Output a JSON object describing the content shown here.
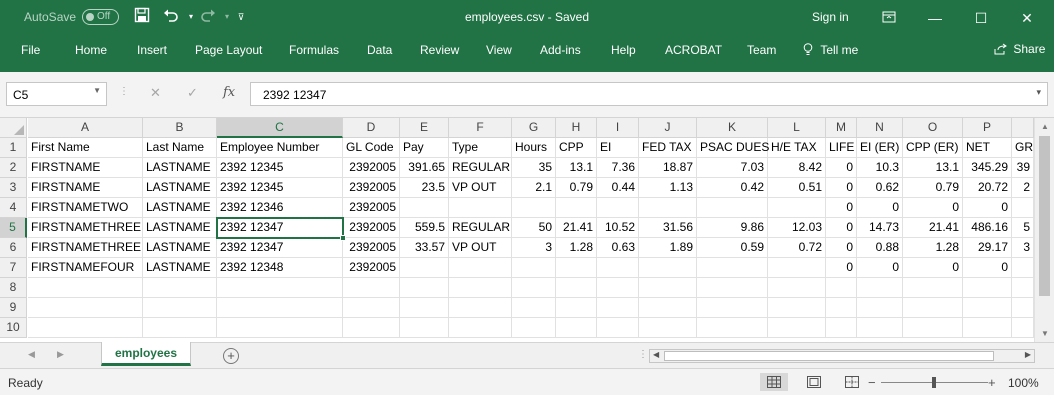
{
  "titlebar": {
    "autosave_label": "AutoSave",
    "autosave_state": "Off",
    "doc_title": "employees.csv  -  Saved",
    "signin": "Sign in",
    "qat_icons": [
      "save-icon",
      "undo-icon",
      "redo-icon",
      "customize-icon"
    ],
    "window_icons": [
      "ribbon-display-icon",
      "minimize-icon",
      "maximize-icon",
      "close-icon"
    ]
  },
  "ribbon": {
    "tabs": [
      "File",
      "Home",
      "Insert",
      "Page Layout",
      "Formulas",
      "Data",
      "Review",
      "View",
      "Add-ins",
      "Help",
      "ACROBAT",
      "Team",
      "Tell me"
    ],
    "share": "Share"
  },
  "formula_bar": {
    "name_box": "C5",
    "formula": "2392  12347",
    "fx": "fx"
  },
  "sheet": {
    "columns": [
      "A",
      "B",
      "C",
      "D",
      "E",
      "F",
      "G",
      "H",
      "I",
      "J",
      "K",
      "L",
      "M",
      "N",
      "O",
      "P",
      ""
    ],
    "row_numbers": [
      "1",
      "2",
      "3",
      "4",
      "5",
      "6",
      "7",
      "8",
      "9",
      "10"
    ],
    "active_cell": "C5",
    "rows": [
      [
        "First Name",
        "Last Name",
        "Employee Number",
        "GL Code",
        "Pay",
        "Type",
        "Hours",
        "CPP",
        "EI",
        "FED TAX",
        "PSAC DUES",
        "H/E TAX",
        "LIFE",
        "EI (ER)",
        "CPP (ER)",
        "NET",
        "GR"
      ],
      [
        "FIRSTNAME",
        "LASTNAME",
        "2392  12345",
        "2392005",
        "391.65",
        "REGULAR",
        "35",
        "13.1",
        "7.36",
        "18.87",
        "7.03",
        "8.42",
        "0",
        "10.3",
        "13.1",
        "345.29",
        "39"
      ],
      [
        "FIRSTNAME",
        "LASTNAME",
        "2392  12345",
        "2392005",
        "23.5",
        "VP OUT",
        "2.1",
        "0.79",
        "0.44",
        "1.13",
        "0.42",
        "0.51",
        "0",
        "0.62",
        "0.79",
        "20.72",
        "2"
      ],
      [
        "FIRSTNAMETWO",
        "LASTNAME",
        "2392  12346",
        "2392005",
        "",
        "",
        "",
        "",
        "",
        "",
        "",
        "",
        "0",
        "0",
        "0",
        "0",
        ""
      ],
      [
        "FIRSTNAMETHREE",
        "LASTNAME",
        "2392  12347",
        "2392005",
        "559.5",
        "REGULAR",
        "50",
        "21.41",
        "10.52",
        "31.56",
        "9.86",
        "12.03",
        "0",
        "14.73",
        "21.41",
        "486.16",
        "5"
      ],
      [
        "FIRSTNAMETHREE",
        "LASTNAME",
        "2392  12347",
        "2392005",
        "33.57",
        "VP OUT",
        "3",
        "1.28",
        "0.63",
        "1.89",
        "0.59",
        "0.72",
        "0",
        "0.88",
        "1.28",
        "29.17",
        "3"
      ],
      [
        "FIRSTNAMEFOUR",
        "LASTNAME",
        "2392  12348",
        "2392005",
        "",
        "",
        "",
        "",
        "",
        "",
        "",
        "",
        "0",
        "0",
        "0",
        "0",
        ""
      ],
      [
        "",
        "",
        "",
        "",
        "",
        "",
        "",
        "",
        "",
        "",
        "",
        "",
        "",
        "",
        "",
        "",
        ""
      ],
      [
        "",
        "",
        "",
        "",
        "",
        "",
        "",
        "",
        "",
        "",
        "",
        "",
        "",
        "",
        "",
        "",
        ""
      ],
      [
        "",
        "",
        "",
        "",
        "",
        "",
        "",
        "",
        "",
        "",
        "",
        "",
        "",
        "",
        "",
        "",
        ""
      ]
    ]
  },
  "sheet_tabs": {
    "active": "employees",
    "add_icon": "plus-circle-icon"
  },
  "status": {
    "ready": "Ready",
    "zoom": "100%",
    "view_icons": [
      "normal-view-icon",
      "page-layout-view-icon",
      "page-break-view-icon"
    ]
  },
  "colors": {
    "accent": "#217346",
    "header_bg": "#f0f0f0",
    "gridline": "#e1e1e1"
  }
}
